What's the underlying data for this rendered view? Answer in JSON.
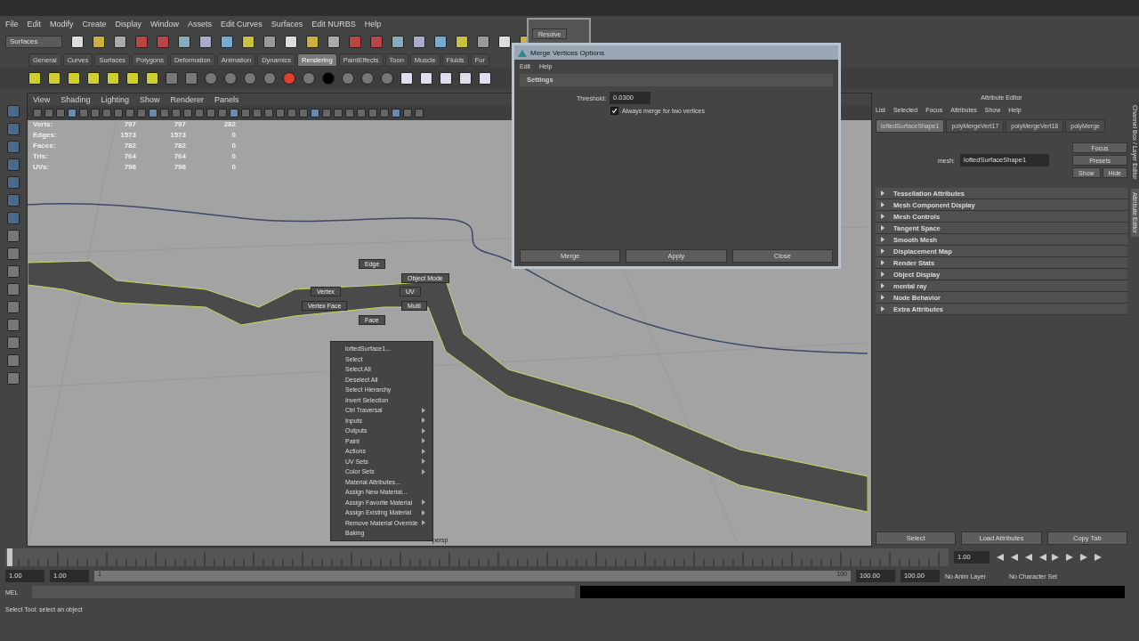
{
  "menu_bar": [
    "File",
    "Edit",
    "Modify",
    "Create",
    "Display",
    "Window",
    "Assets",
    "Edit Curves",
    "Surfaces",
    "Edit NURBS",
    "Help"
  ],
  "status_line": {
    "menu_set": "Surfaces"
  },
  "shelf_tabs": [
    {
      "label": "General",
      "selected": false
    },
    {
      "label": "Curves",
      "selected": false
    },
    {
      "label": "Surfaces",
      "selected": false
    },
    {
      "label": "Polygons",
      "selected": false
    },
    {
      "label": "Deformation",
      "selected": false
    },
    {
      "label": "Animation",
      "selected": false
    },
    {
      "label": "Dynamics",
      "selected": false
    },
    {
      "label": "Rendering",
      "selected": true
    },
    {
      "label": "PaintEffects",
      "selected": false
    },
    {
      "label": "Toon",
      "selected": false
    },
    {
      "label": "Muscle",
      "selected": false
    },
    {
      "label": "Fluids",
      "selected": false
    },
    {
      "label": "Fur",
      "selected": false
    }
  ],
  "viewport": {
    "menu": [
      "View",
      "Shading",
      "Lighting",
      "Show",
      "Renderer",
      "Panels"
    ],
    "hud": [
      {
        "label": "Verts:",
        "values": [
          "797",
          "797",
          "282"
        ]
      },
      {
        "label": "Edges:",
        "values": [
          "1573",
          "1573",
          "0"
        ]
      },
      {
        "label": "Faces:",
        "values": [
          "782",
          "782",
          "0"
        ]
      },
      {
        "label": "Tris:",
        "values": [
          "764",
          "764",
          "0"
        ]
      },
      {
        "label": "UVs:",
        "values": [
          "798",
          "798",
          "0"
        ]
      }
    ],
    "camera": "persp",
    "marking_menu": [
      "Edge",
      "Object Mode",
      "Vertex",
      "UV",
      "Vertex Face",
      "Multi",
      "Face"
    ],
    "context_menu": [
      {
        "label": "loftedSurface1...",
        "submenu": false
      },
      {
        "label": "Select",
        "submenu": false
      },
      {
        "label": "Select All",
        "submenu": false
      },
      {
        "label": "Deselect All",
        "submenu": false
      },
      {
        "label": "Select Hierarchy",
        "submenu": false
      },
      {
        "label": "Invert Selection",
        "submenu": false
      },
      {
        "label": "Ctrl Traversal",
        "submenu": true
      },
      {
        "label": "Inputs",
        "submenu": true
      },
      {
        "label": "Outputs",
        "submenu": true
      },
      {
        "label": "Paint",
        "submenu": true
      },
      {
        "label": "Actions",
        "submenu": true
      },
      {
        "label": "UV Sets",
        "submenu": true
      },
      {
        "label": "Color Sets",
        "submenu": true
      },
      {
        "label": "Material Attributes...",
        "submenu": false
      },
      {
        "label": "Assign New Material...",
        "submenu": false
      },
      {
        "label": "Assign Favorite Material",
        "submenu": true
      },
      {
        "label": "Assign Existing Material",
        "submenu": true
      },
      {
        "label": "Remove Material Override",
        "submenu": true
      },
      {
        "label": "Baking",
        "submenu": false
      }
    ]
  },
  "back_window": {
    "button": "Resolve"
  },
  "merge_dialog": {
    "title": "Merge Vertices Options",
    "menu": [
      "Edit",
      "Help"
    ],
    "section": "Settings",
    "threshold_label": "Threshold:",
    "threshold": "0.0300",
    "checkbox": {
      "label": "Always merge for two vertices",
      "checked": true
    },
    "buttons": [
      "Merge",
      "Apply",
      "Close"
    ]
  },
  "attribute_editor": {
    "title": "Attribute Editor",
    "menu": [
      "List",
      "Selected",
      "Focus",
      "Attributes",
      "Show",
      "Help"
    ],
    "tabs": [
      {
        "label": "loftedSurfaceShape1",
        "selected": true
      },
      {
        "label": "polyMergeVert17",
        "selected": false
      },
      {
        "label": "polyMergeVert18",
        "selected": false
      },
      {
        "label": "polyMerge",
        "selected": false
      }
    ],
    "node_label": "mesh:",
    "node_name": "loftedSurfaceShape1",
    "side_buttons": [
      "Focus",
      "Presets",
      "Show",
      "Hide"
    ],
    "sections": [
      "Tessellation Attributes",
      "Mesh Component Display",
      "Mesh Controls",
      "Tangent Space",
      "Smooth Mesh",
      "Displacement Map",
      "Render Stats",
      "Object Display",
      "mental ray",
      "Node Behavior",
      "Extra Attributes"
    ],
    "bottom_buttons": [
      "Select",
      "Load Attributes",
      "Copy Tab"
    ],
    "side_tabs": [
      "Channel Box / Layer Editor",
      "Attribute Editor"
    ]
  },
  "timeline": {
    "current_frame": "1.00",
    "level": 0
  },
  "range": {
    "start": "1.00",
    "playback_start": "1.00",
    "bar_start": "1",
    "bar_end": "100",
    "level": 1,
    "playback_end": "100.00",
    "end": "100.00",
    "anim_layer": "No Anim Layer",
    "character_set": "No Character Set"
  },
  "command_line": {
    "label": "MEL"
  },
  "help_line": "Select Tool: select an object"
}
